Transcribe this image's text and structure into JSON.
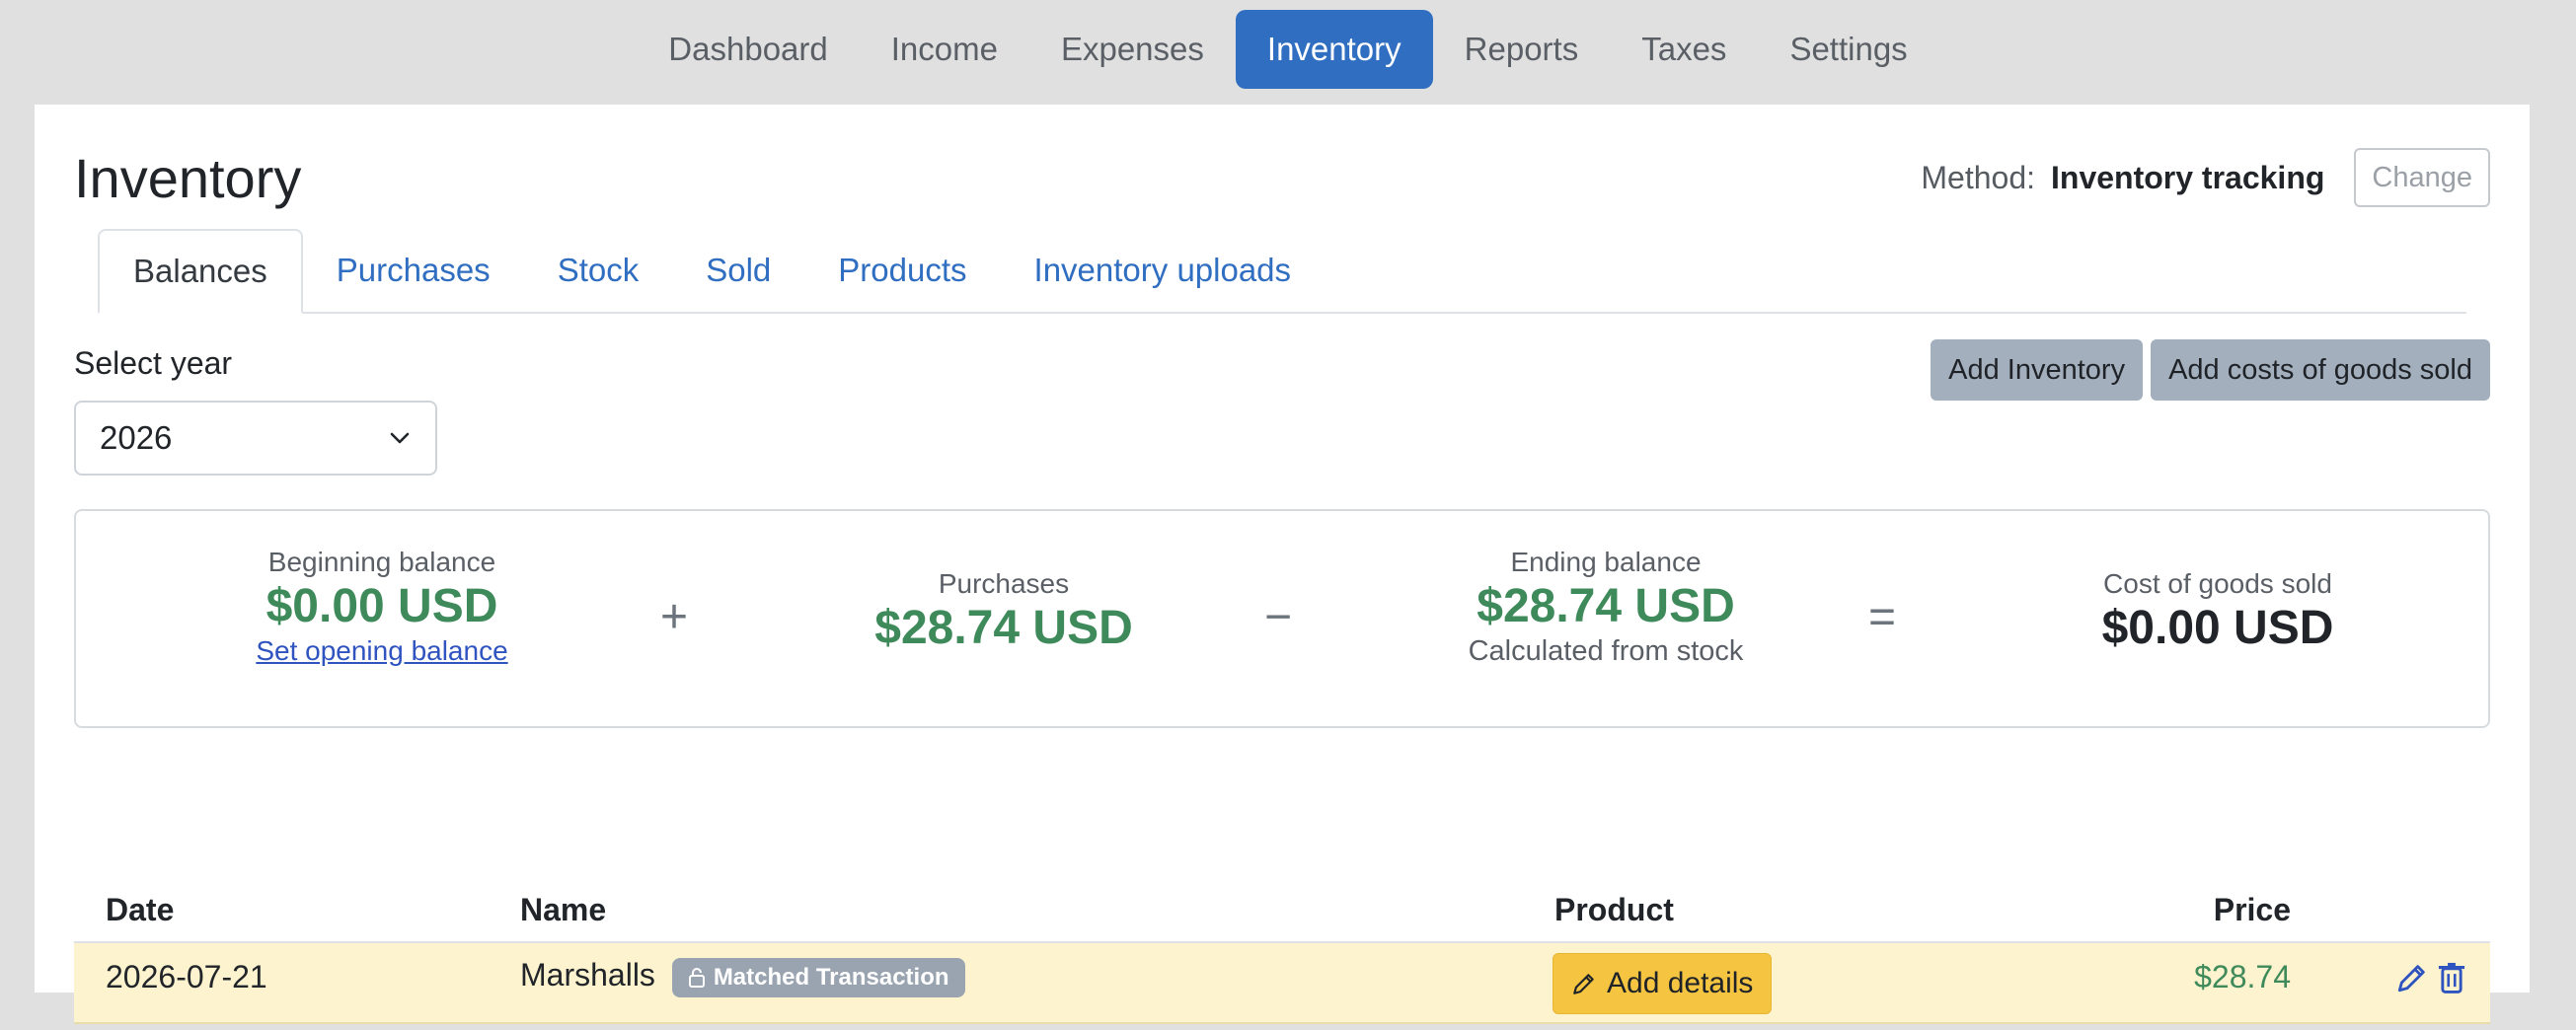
{
  "nav": {
    "items": [
      "Dashboard",
      "Income",
      "Expenses",
      "Inventory",
      "Reports",
      "Taxes",
      "Settings"
    ],
    "active": "Inventory"
  },
  "page": {
    "title": "Inventory",
    "method_label": "Method:",
    "method_value": "Inventory tracking",
    "change_label": "Change"
  },
  "tabs": [
    "Balances",
    "Purchases",
    "Stock",
    "Sold",
    "Products",
    "Inventory uploads"
  ],
  "active_tab": "Balances",
  "year": {
    "label": "Select year",
    "selected": "2026"
  },
  "actions": {
    "add_inventory": "Add Inventory",
    "add_cogs": "Add costs of goods sold"
  },
  "summary": {
    "beginning": {
      "label": "Beginning balance",
      "value": "$0.00 USD",
      "link": "Set opening balance"
    },
    "plus": "+",
    "purchases": {
      "label": "Purchases",
      "value": "$28.74 USD"
    },
    "minus": "−",
    "ending": {
      "label": "Ending balance",
      "value": "$28.74 USD",
      "note": "Calculated from stock"
    },
    "equals": "=",
    "cogs": {
      "label": "Cost of goods sold",
      "value": "$0.00 USD"
    }
  },
  "table": {
    "headers": {
      "date": "Date",
      "name": "Name",
      "product": "Product",
      "price": "Price"
    },
    "rows": [
      {
        "date": "2026-07-21",
        "name": "Marshalls",
        "badge": "Matched Transaction",
        "product_action": "Add details",
        "price": "$28.74"
      }
    ]
  },
  "colors": {
    "accent": "#2f6ec0",
    "positive": "#3f8a5a",
    "row_highlight": "#fdf3cf",
    "warning_button": "#f5c542"
  }
}
